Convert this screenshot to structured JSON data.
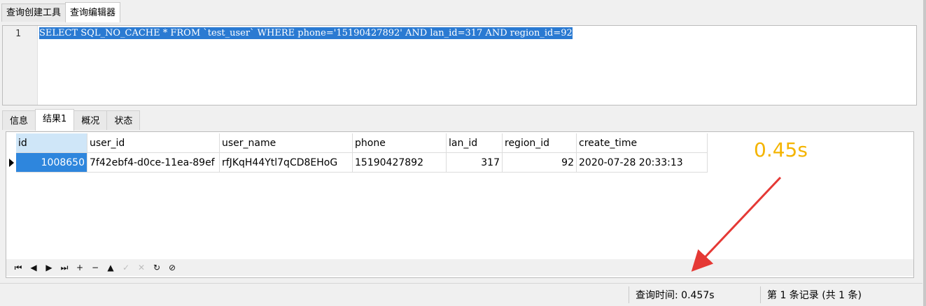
{
  "top_tabs": [
    {
      "label": "查询创建工具"
    },
    {
      "label": "查询编辑器"
    }
  ],
  "editor": {
    "line_number": "1",
    "sql": "SELECT SQL_NO_CACHE * FROM `test_user` WHERE phone='15190427892' AND lan_id=317 AND region_id=92"
  },
  "result_tabs": [
    {
      "label": "信息"
    },
    {
      "label": "结果1"
    },
    {
      "label": "概况"
    },
    {
      "label": "状态"
    }
  ],
  "table": {
    "columns": [
      "id",
      "user_id",
      "user_name",
      "phone",
      "lan_id",
      "region_id",
      "create_time"
    ],
    "rows": [
      [
        "1008650",
        "7f42ebf4-d0ce-11ea-89ef",
        "rfJKqH44Ytl7qCD8EHoG",
        "15190427892",
        "317",
        "92",
        "2020-07-28 20:33:13"
      ]
    ]
  },
  "toolbar": {
    "buttons": [
      {
        "icon": "first-record-icon",
        "glyph": "⏮"
      },
      {
        "icon": "prev-record-icon",
        "glyph": "◀"
      },
      {
        "icon": "next-record-icon",
        "glyph": "▶"
      },
      {
        "icon": "last-record-icon",
        "glyph": "⏭"
      },
      {
        "icon": "add-record-icon",
        "glyph": "+"
      },
      {
        "icon": "delete-record-icon",
        "glyph": "−"
      },
      {
        "icon": "apply-icon",
        "glyph": "▲"
      },
      {
        "icon": "check-icon",
        "glyph": "✓"
      },
      {
        "icon": "cancel-icon",
        "glyph": "✕"
      },
      {
        "icon": "refresh-icon",
        "glyph": "↻"
      },
      {
        "icon": "stop-icon",
        "glyph": "⊘"
      }
    ]
  },
  "status": {
    "query_time": "查询时间: 0.457s",
    "record_count": "第 1 条记录 (共 1 条)"
  },
  "annotation": {
    "text": "0.45s",
    "color": "#f4b400",
    "arrow_color": "#e53935"
  }
}
